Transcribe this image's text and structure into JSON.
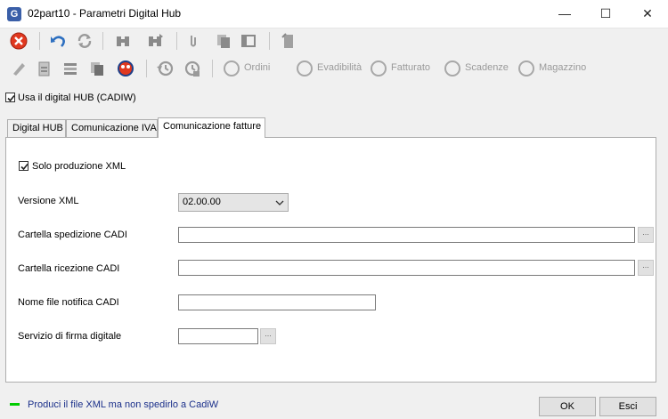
{
  "window": {
    "title": "02part10 - Parametri Digital Hub",
    "app_icon_letter": "G",
    "minimize_glyph": "—",
    "maximize_glyph": "☐",
    "close_glyph": "✕"
  },
  "toolbar2": {
    "ordini_label": "Ordini",
    "evadibilita_label": "Evadibilità",
    "fatturato_label": "Fatturato",
    "scadenze_label": "Scadenze",
    "magazzino_label": "Magazzino"
  },
  "use_hub": {
    "label": "Usa il digital HUB (CADIW)",
    "checked": true
  },
  "tabs": [
    {
      "label": "Digital HUB",
      "active": false
    },
    {
      "label": "Comunicazione IVA",
      "active": false
    },
    {
      "label": "Comunicazione fatture",
      "active": true
    }
  ],
  "form": {
    "solo_xml_label": "Solo produzione XML",
    "solo_xml_checked": true,
    "versione_label": "Versione XML",
    "versione_value": "02.00.00",
    "cartella_spedizione_label": "Cartella spedizione CADI",
    "cartella_spedizione_value": "",
    "cartella_ricezione_label": "Cartella ricezione CADI",
    "cartella_ricezione_value": "",
    "nome_file_label": "Nome file notifica CADI",
    "nome_file_value": "",
    "servizio_firma_label": "Servizio di firma digitale",
    "servizio_firma_value": "",
    "browse_label": "..."
  },
  "status": {
    "message": "Produci il file XML ma non spedirlo a CadiW",
    "indicator_color": "#00cc00"
  },
  "buttons": {
    "ok_label": "OK",
    "esci_label": "Esci"
  }
}
